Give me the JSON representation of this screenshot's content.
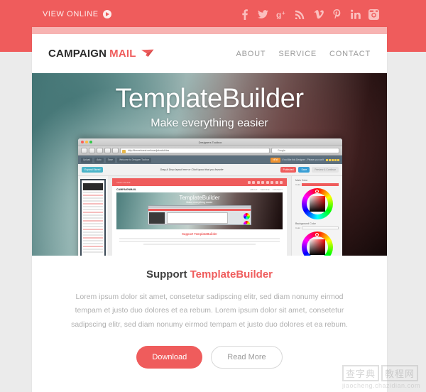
{
  "topbar": {
    "view_online_label": "VIEW ONLINE",
    "play_icon": "play-circle-icon",
    "background_color": "#ef5c5c",
    "socials": [
      {
        "name": "facebook",
        "glyph": "f"
      },
      {
        "name": "twitter",
        "glyph": "twitter-bird"
      },
      {
        "name": "googleplus",
        "glyph": "g+"
      },
      {
        "name": "rss",
        "glyph": "rss-waves"
      },
      {
        "name": "vimeo",
        "glyph": "V"
      },
      {
        "name": "pinterest",
        "glyph": "p"
      },
      {
        "name": "linkedin",
        "glyph": "in"
      },
      {
        "name": "instagram",
        "glyph": "camera"
      }
    ]
  },
  "header": {
    "logo_part1": "CAMPAIGN",
    "logo_part2": "MAIL",
    "logo_icon": "paper-plane-icon",
    "logo_accent_color": "#ef5c5c",
    "nav": [
      {
        "label": "ABOUT"
      },
      {
        "label": "SERVICE"
      },
      {
        "label": "CONTACT"
      }
    ]
  },
  "hero": {
    "title": "TemplateBuilder",
    "subtitle": "Make everything easier",
    "mockup": {
      "window_title": "Designers Toolbox",
      "url": "http://themeforest.net/user/jakeclub/ies",
      "search_placeholder": "Google",
      "appbar_left": [
        "Upload",
        "Auto",
        "Save",
        "Welcome to Designer Toolbox"
      ],
      "appbar_badge": "NEW",
      "appbar_right": "If not like this Designer - Please you can't",
      "toolbar_tag_left": "Expand Stored",
      "toolbar_hint": "Drag & Drop layout here or Click layout that you favorite",
      "toolbar_tag_red": "Published",
      "toolbar_tag_blue": "Save",
      "toolbar_tag_gray": "Preview & Continue",
      "inner": {
        "logo": "CAMPAIGNMAIL",
        "nav": [
          "ABOUT",
          "SERVICE",
          "CONTACT"
        ],
        "hero_title": "TemplateBuilder",
        "hero_subtitle": "Make everything easier",
        "support_prefix": "Support ",
        "support_accent": "TemplateBuilder"
      },
      "right_panel": {
        "main_color_label": "Main Color",
        "main_color_field_label": "Color",
        "main_color_value": "#ef5c5c",
        "background_color_label": "Background Color",
        "background_color_field_label": "Color",
        "background_color_value": "#ffffff"
      }
    }
  },
  "content": {
    "heading_prefix": "Support ",
    "heading_accent": "TemplateBuilder",
    "paragraph": "Lorem ipsum dolor sit amet, consetetur sadipscing elitr, sed diam nonumy eirmod tempam et justo duo dolores et ea rebum. Lorem ipsum dolor sit amet, consetetur sadipscing elitr, sed diam nonumy eirmod tempam et justo duo dolores et ea rebum.",
    "primary_button": "Download",
    "secondary_button": "Read More"
  },
  "watermark": {
    "text_1": "查字典",
    "text_2": "教程网",
    "url": "jiaocheng.chazidian.com"
  }
}
